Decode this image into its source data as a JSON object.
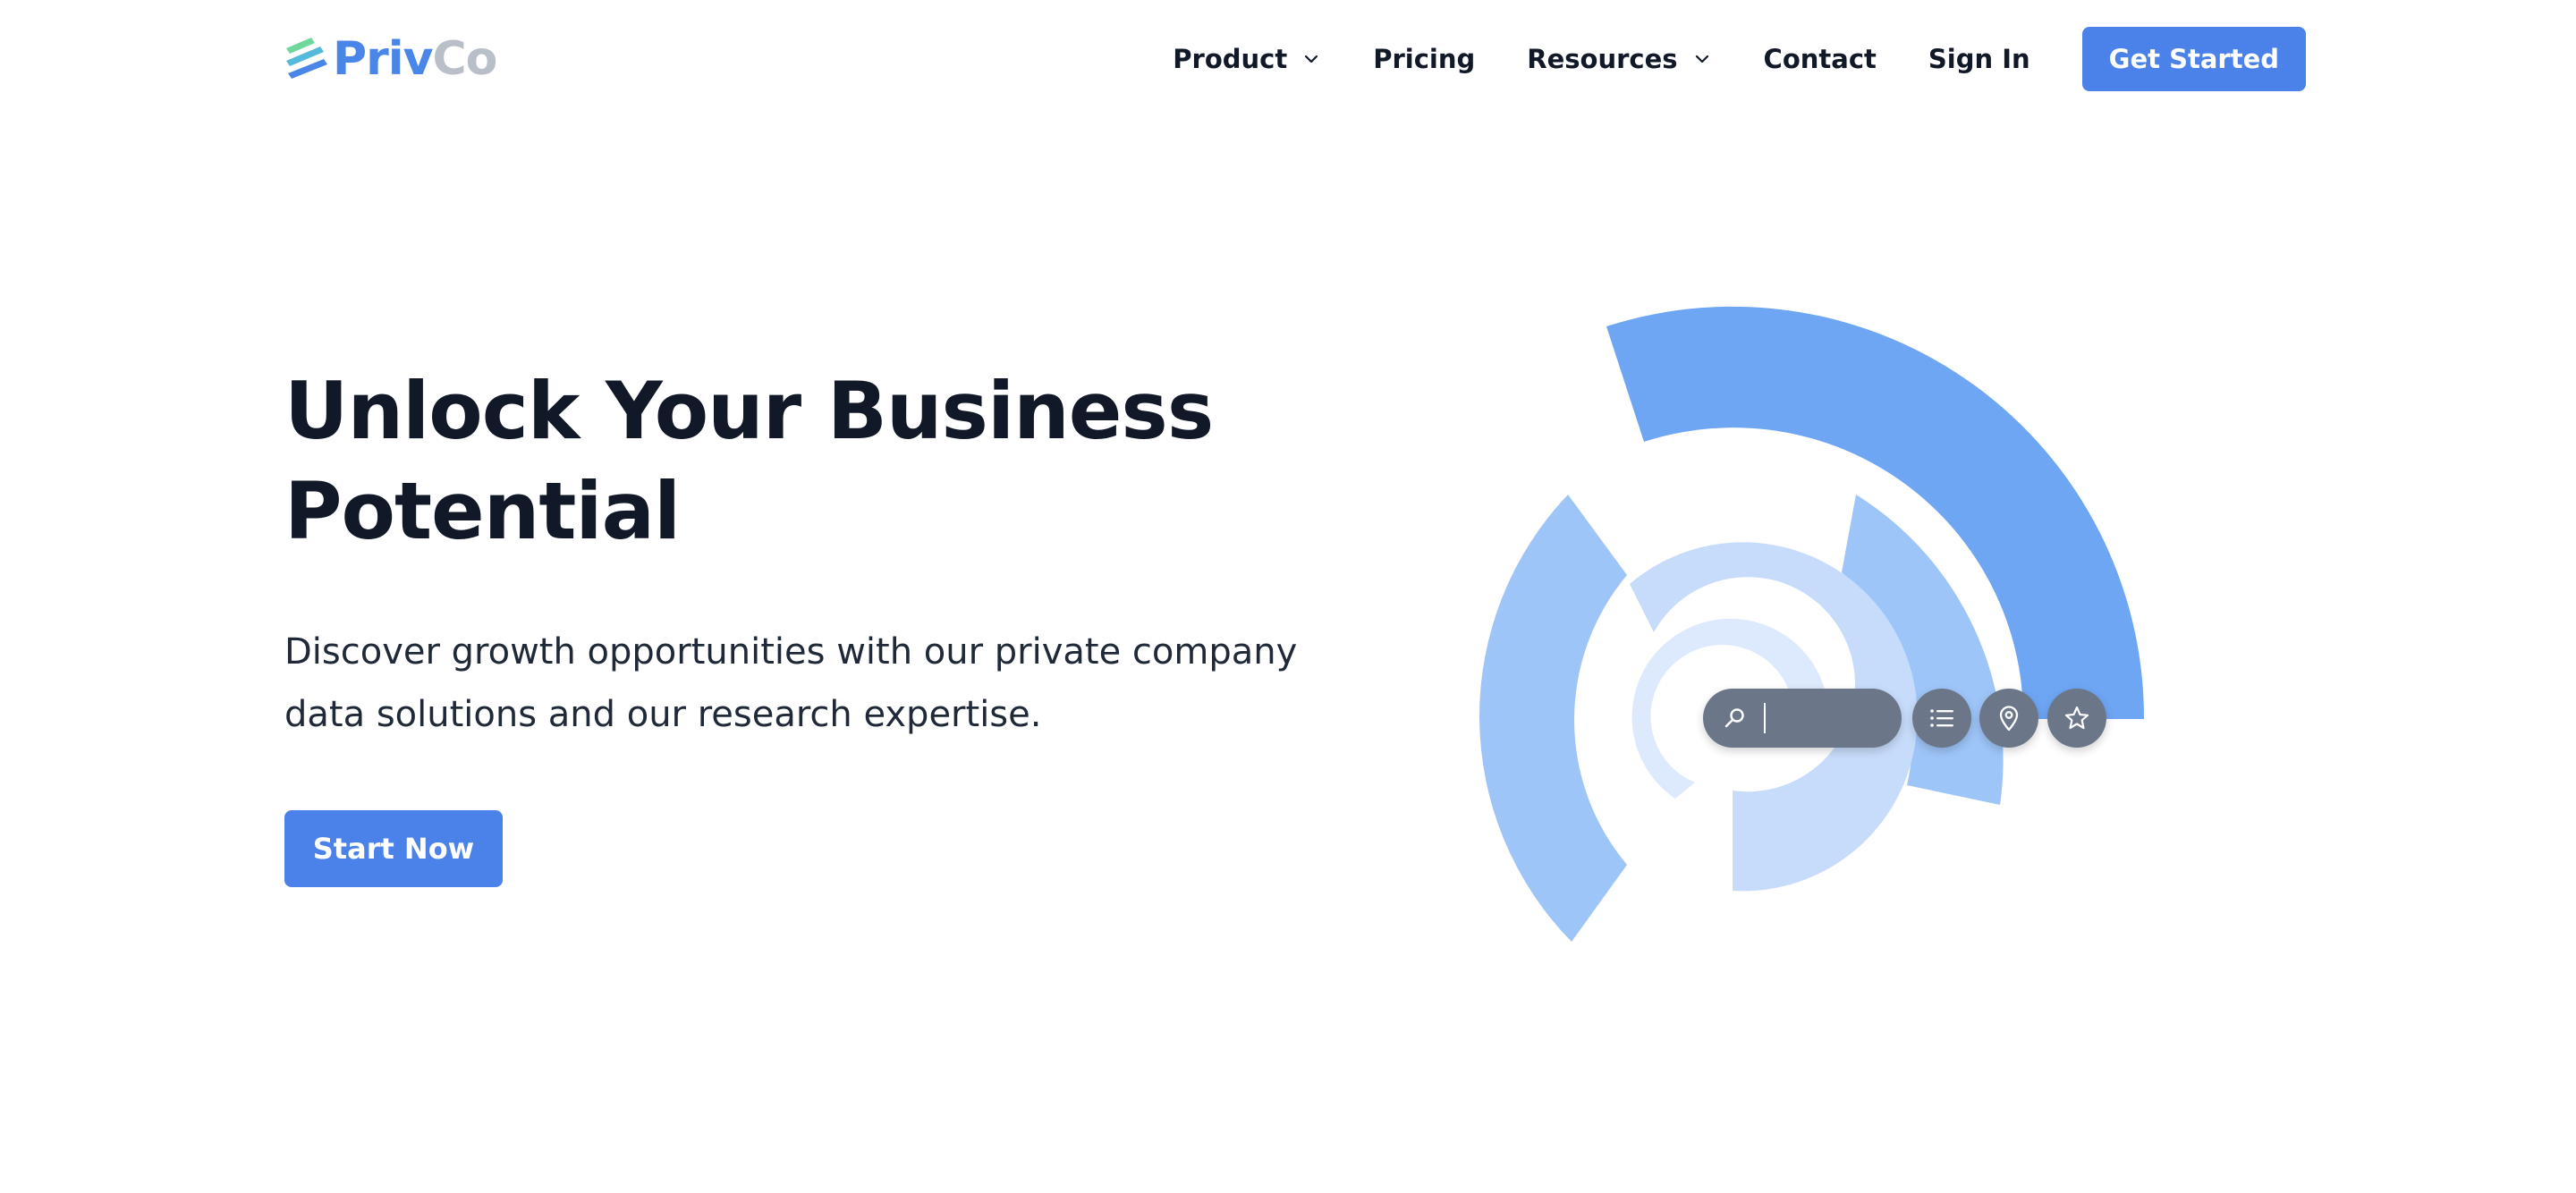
{
  "brand": {
    "logo_part1": "Priv",
    "logo_part2": "Co",
    "logo_icon": "privco-stripes-icon"
  },
  "nav": {
    "items": [
      {
        "label": "Product",
        "has_dropdown": true
      },
      {
        "label": "Pricing",
        "has_dropdown": false
      },
      {
        "label": "Resources",
        "has_dropdown": true
      },
      {
        "label": "Contact",
        "has_dropdown": false
      },
      {
        "label": "Sign In",
        "has_dropdown": false
      }
    ],
    "cta_label": "Get Started"
  },
  "hero": {
    "title_line1": "Unlock Your Business",
    "title_line2": "Potential",
    "subtitle_line1": "Discover growth opportunities with our private company",
    "subtitle_line2": "data solutions and our research expertise.",
    "button_label": "Start Now"
  },
  "illustration": {
    "icons": [
      "search-icon",
      "list-icon",
      "map-pin-icon",
      "star-icon"
    ]
  },
  "colors": {
    "accent": "#4a82ea",
    "arc_dark": "#6ea6f4",
    "arc_mid": "#9ec5f8",
    "arc_light": "#c7dcfb",
    "arc_lightest": "#dde9fc",
    "toolbar": "#6b7689",
    "text": "#111827"
  }
}
